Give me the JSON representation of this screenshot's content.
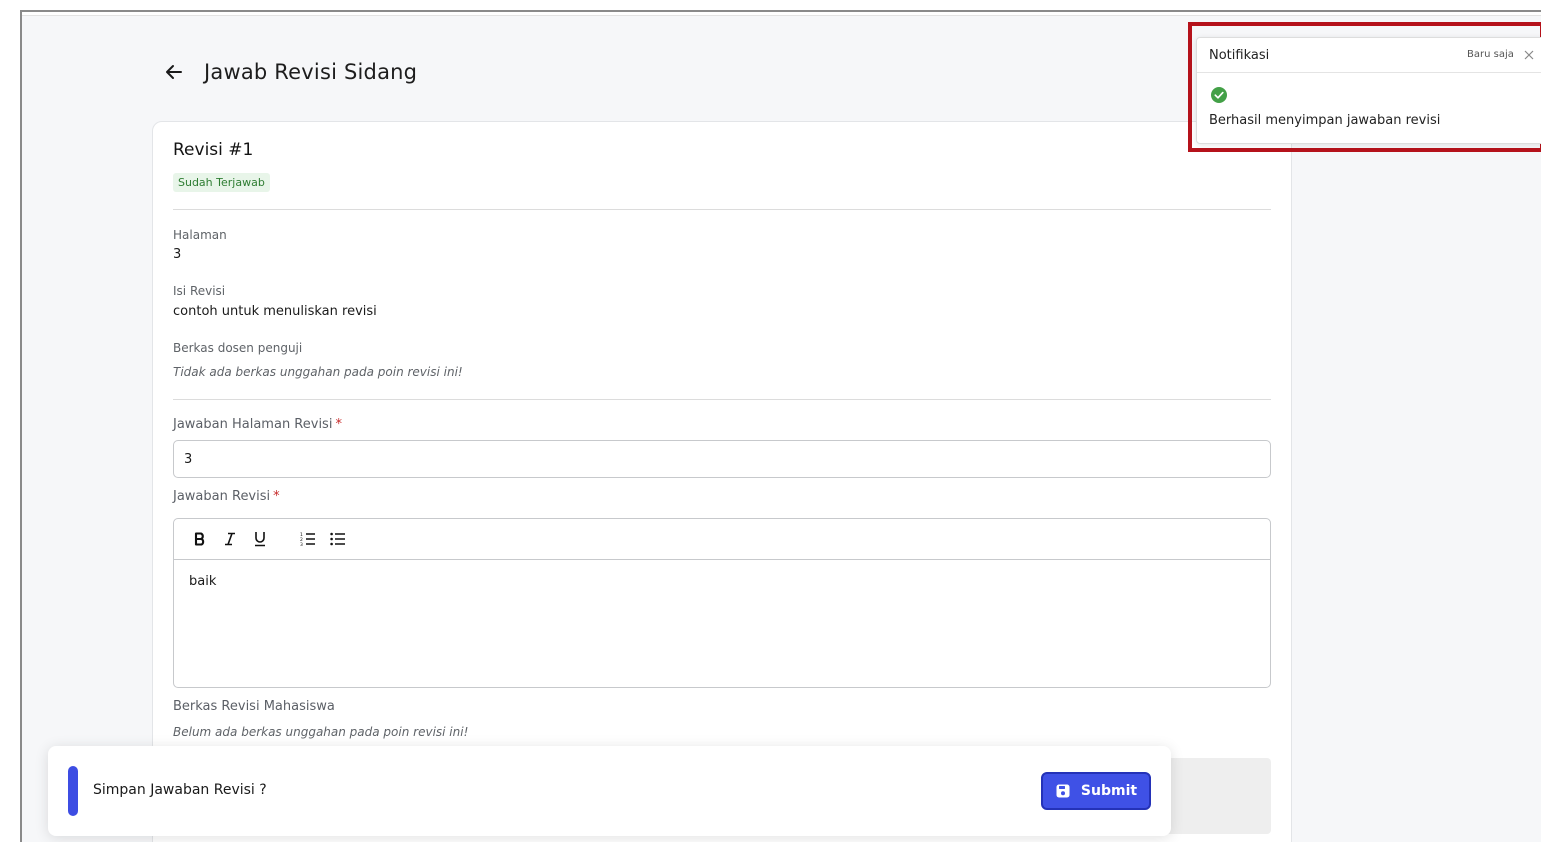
{
  "header": {
    "title": "Jawab Revisi Sidang"
  },
  "revision": {
    "title": "Revisi #1",
    "status_badge": "Sudah Terjawab",
    "page_label": "Halaman",
    "page_value": "3",
    "content_label": "Isi Revisi",
    "content_value": "contoh untuk menuliskan revisi",
    "examiner_files_label": "Berkas dosen penguji",
    "examiner_files_note": "Tidak ada berkas unggahan pada poin revisi ini!"
  },
  "form": {
    "answer_page_label": "Jawaban Halaman Revisi",
    "answer_page_value": "3",
    "answer_label": "Jawaban Revisi",
    "required_mark": "*",
    "editor_toolbar": [
      {
        "name": "bold-icon",
        "glyph": "B"
      },
      {
        "name": "italic-icon",
        "glyph": "I"
      },
      {
        "name": "underline-icon",
        "glyph": "U"
      },
      {
        "name": "ordered-list-icon",
        "glyph": "ordered"
      },
      {
        "name": "bullet-list-icon",
        "glyph": "bullet"
      }
    ],
    "answer_value": "baik",
    "student_files_label": "Berkas Revisi Mahasiswa",
    "student_files_note": "Belum ada berkas unggahan pada poin revisi ini!"
  },
  "bottom_bar": {
    "prompt": "Simpan Jawaban Revisi ?",
    "submit_label": "Submit",
    "accent_color": "#3d4de3"
  },
  "notification": {
    "title": "Notifikasi",
    "time": "Baru saja",
    "message": "Berhasil menyimpan jawaban revisi",
    "success_color": "#43a047",
    "highlight_color": "#b5121b"
  }
}
